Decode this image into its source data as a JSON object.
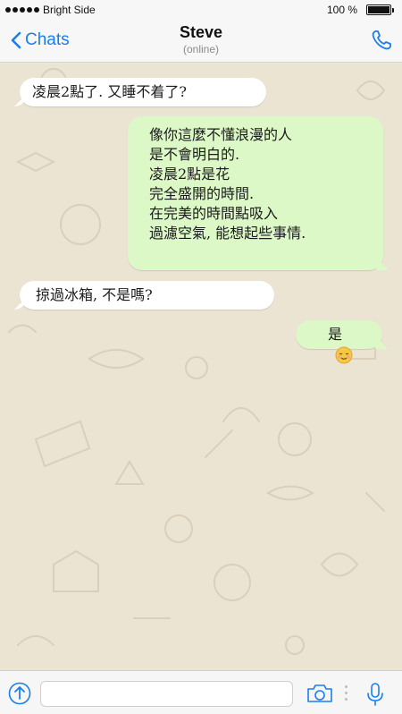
{
  "status_bar": {
    "carrier": "Bright Side",
    "battery_percent": "100 %",
    "battery_level": 1.0,
    "signal_bars": 5
  },
  "nav": {
    "back_label": "Chats",
    "contact_name": "Steve",
    "contact_status": "(online)",
    "accent_color": "#1a7ef0"
  },
  "messages": [
    {
      "direction": "incoming",
      "text": "凌晨2點了. 又睡不着了?"
    },
    {
      "direction": "outgoing",
      "lines": [
        "像你這麼不懂浪漫的人",
        "是不會明白的.",
        "凌晨2點是花",
        "完全盛開的時間.",
        "在完美的時間點吸入",
        "過濾空氣, 能想起些事情."
      ]
    },
    {
      "direction": "incoming",
      "text": "掠過冰箱, 不是嗎?"
    },
    {
      "direction": "outgoing",
      "text": "是",
      "emoji": "relieved-face"
    }
  ],
  "input_bar": {
    "value": "",
    "placeholder": ""
  },
  "colors": {
    "incoming_bubble": "#ffffff",
    "outgoing_bubble": "#dcf8c6",
    "wallpaper": "#ece4d3"
  }
}
